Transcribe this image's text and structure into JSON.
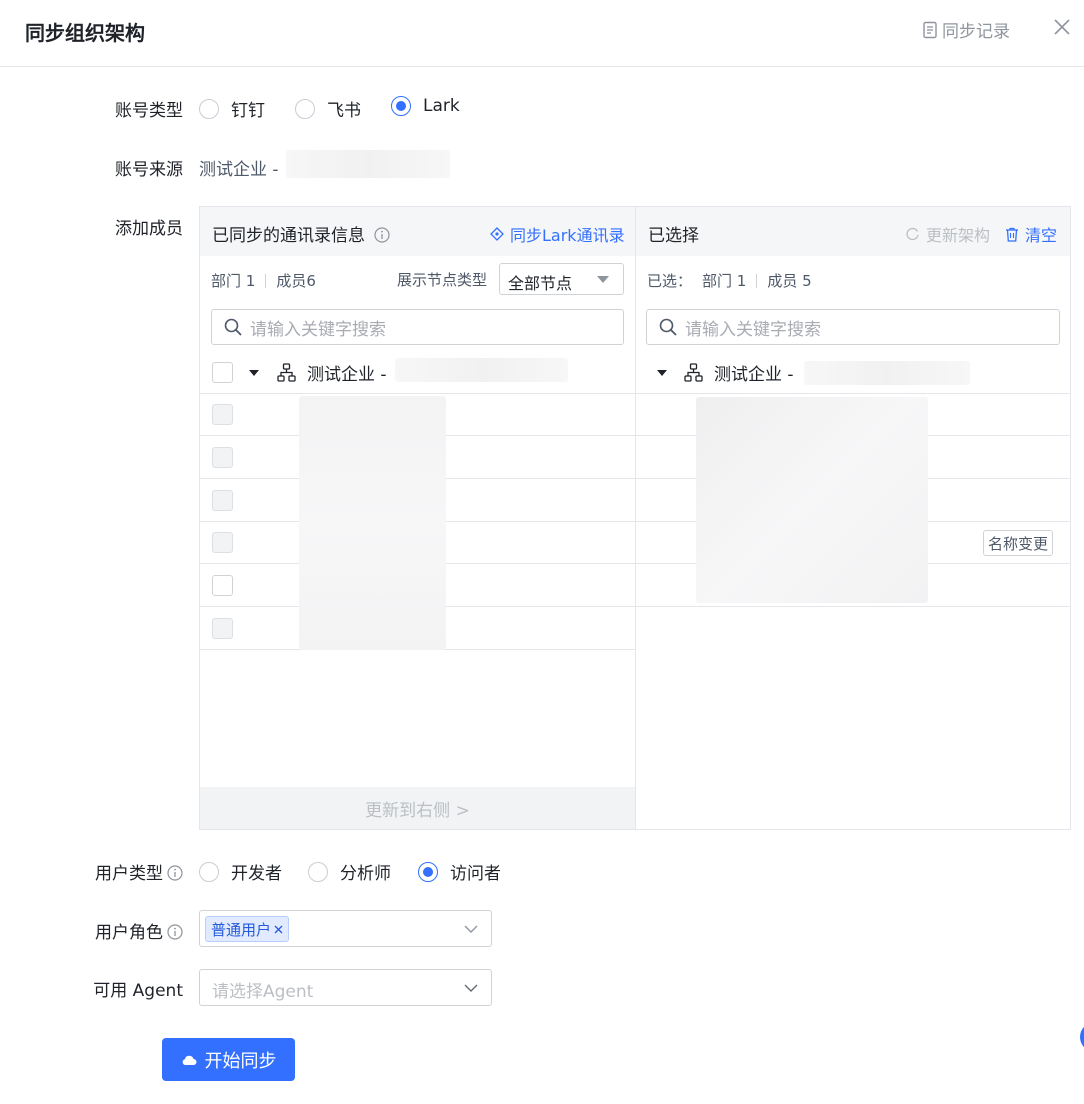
{
  "dialog": {
    "title": "同步组织架构",
    "sync_log_label": "同步记录"
  },
  "account_type": {
    "label": "账号类型",
    "options": [
      {
        "label": "钉钉",
        "checked": false
      },
      {
        "label": "飞书",
        "checked": false
      },
      {
        "label": "Lark",
        "checked": true
      }
    ]
  },
  "account_source": {
    "label": "账号来源",
    "value": "测试企业 -"
  },
  "add_members": {
    "label": "添加成员",
    "left": {
      "title": "已同步的通讯录信息",
      "sync_link": "同步Lark通讯录",
      "dept_stat": "部门 1",
      "member_stat": "成员6",
      "node_type_label": "展示节点类型",
      "node_type_value": "全部节点",
      "search_placeholder": "请输入关键字搜索",
      "root_node": "测试企业 -",
      "footer_button": "更新到右侧 >"
    },
    "right": {
      "title": "已选择",
      "refresh_label": "更新架构",
      "clear_label": "清空",
      "selected_label": "已选：",
      "dept_stat": "部门 1",
      "member_stat": "成员 5",
      "search_placeholder": "请输入关键字搜索",
      "root_node": "测试企业 -",
      "rename_badge": "名称变更"
    }
  },
  "user_type": {
    "label": "用户类型",
    "options": [
      {
        "label": "开发者",
        "checked": false
      },
      {
        "label": "分析师",
        "checked": false
      },
      {
        "label": "访问者",
        "checked": true
      }
    ]
  },
  "user_role": {
    "label": "用户角色",
    "tag": "普通用户"
  },
  "agent": {
    "label": "可用 Agent",
    "placeholder": "请选择Agent"
  },
  "start_button": "开始同步",
  "colors": {
    "primary": "#3370ff",
    "border": "#d0d3d6",
    "head_bg": "#f5f6f7"
  }
}
